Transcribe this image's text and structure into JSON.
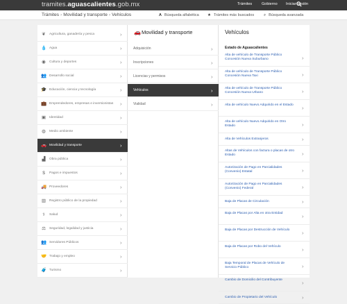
{
  "header": {
    "logo_prefix": "tramites.",
    "logo_main": "aguascalientes",
    "logo_suffix": ".gob.mx",
    "nav": {
      "tramites": "Trámites",
      "gobierno": "Gobierno",
      "login": "Iniciar sesión"
    }
  },
  "breadcrumb": {
    "items": [
      "Trámites",
      "Movilidad y transporte",
      "Vehículos"
    ],
    "separator": "›"
  },
  "tools": {
    "alpha": "Búsqueda alfabética",
    "popular": "Trámites más buscados",
    "advanced": "Búsqueda avanzada"
  },
  "categories": [
    {
      "label": "Agricultura, ganadería y pesca",
      "icon": "leaf-icon",
      "glyph": "❦"
    },
    {
      "label": "Agua",
      "icon": "water-drop-icon",
      "glyph": "💧"
    },
    {
      "label": "Cultura y deportes",
      "icon": "soccer-ball-icon",
      "glyph": "◉"
    },
    {
      "label": "Desarrollo social",
      "icon": "users-icon",
      "glyph": "👥"
    },
    {
      "label": "Educación, ciencia y tecnología",
      "icon": "graduation-cap-icon",
      "glyph": "🎓"
    },
    {
      "label": "Emprendedores, empresas e inversionistas",
      "icon": "briefcase-icon",
      "glyph": "💼"
    },
    {
      "label": "Identidad",
      "icon": "id-card-icon",
      "glyph": "▣"
    },
    {
      "label": "Medio ambiente",
      "icon": "globe-icon",
      "glyph": "◍"
    },
    {
      "label": "Movilidad y transporte",
      "icon": "car-icon",
      "glyph": "🚗"
    },
    {
      "label": "Obra pública",
      "icon": "road-icon",
      "glyph": "▟"
    },
    {
      "label": "Pagos e impuestos",
      "icon": "dollar-icon",
      "glyph": "$"
    },
    {
      "label": "Proveedores",
      "icon": "truck-icon",
      "glyph": "🚚"
    },
    {
      "label": "Registro público de la propiedad",
      "icon": "building-icon",
      "glyph": "▥"
    },
    {
      "label": "Salud",
      "icon": "stethoscope-icon",
      "glyph": "⚕"
    },
    {
      "label": "Seguridad, legalidad y justicia",
      "icon": "scales-icon",
      "glyph": "⚖"
    },
    {
      "label": "Servidores Públicos",
      "icon": "people-icon",
      "glyph": "👥"
    },
    {
      "label": "Trabajo y empleo",
      "icon": "handshake-icon",
      "glyph": "🤝"
    },
    {
      "label": "Turismo",
      "icon": "suitcase-icon",
      "glyph": "🧳"
    }
  ],
  "active_category_index": 8,
  "subcategory_panel": {
    "title": "Movilidad y transporte",
    "items": [
      "Adquisición",
      "Inscripciones",
      "Licencias y permisos",
      "Vehículos",
      "Vialidad"
    ],
    "active_index": 3
  },
  "procedures_panel": {
    "title": "Vehículos",
    "group": "Estado de Aguascalientes",
    "items": [
      "Alta de vehículo de Transporte Público Concesión Nueva Suburbano",
      "Alta de vehículo de Transporte Público Concesión Nueva Taxi",
      "Alta de vehículo de Transporte Público Concesión Nueva Urbano",
      "Alta de vehículo Nuevo Adquirido en el Estado",
      "Alta de vehículo Nuevo Adquirido en Otro Estado",
      "Alta de Vehículos Extranjeros",
      "Altas de Vehículos con factura o placas de otro Estado",
      "Autorización de Pago en Parcialidades (Convenio) Estatal",
      "Autorización de Pago en Parcialidades (Convenio) Federal",
      "Baja de Placas de Circulación",
      "Baja de Placas por Alta en otra Entidad",
      "Baja de Placas por Destrucción de Vehículo",
      "Baja de Placas por Robo del Vehículo",
      "Baja Temporal de Placas de Vehículo de Servicio Público",
      "Cambio de Domicilio del Contribuyente",
      "Cambio de Propietario del Vehículo"
    ]
  }
}
